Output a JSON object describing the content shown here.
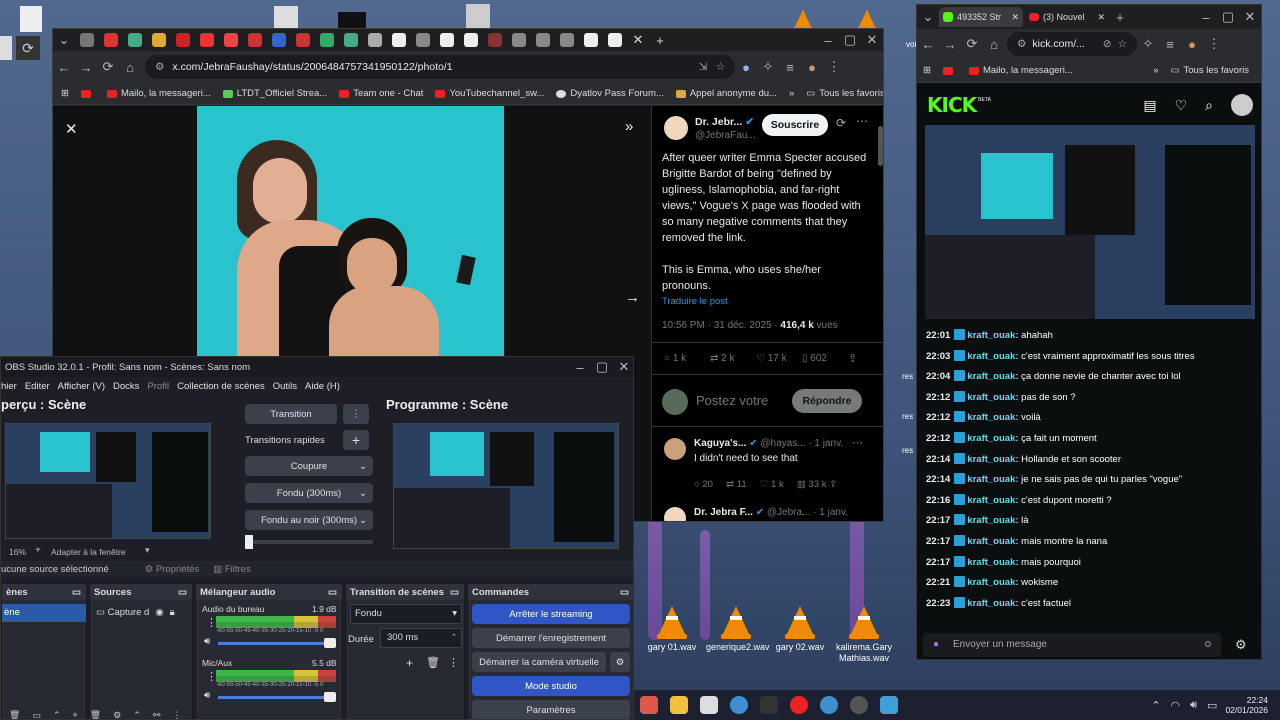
{
  "chrome_main": {
    "url": "x.com/JebraFaushay/status/2006484757341950122/photo/1",
    "bookmarks": [
      "Mailo, la messageri...",
      "LTDT_Officiel Strea...",
      "Team one - Chat",
      "YouTubechannel_sw...",
      "Dyatlov Pass Forum...",
      "Appel anonyme du..."
    ],
    "all_bookmarks": "Tous les favoris"
  },
  "tweet": {
    "author": "Dr. Jebr...",
    "handle": "@JebraFau...",
    "follow": "Suivre",
    "subscribe": "Souscrire",
    "text": "After queer writer Emma Specter accused Brigitte Bardot of being \"defined by ugliness, Islamophobia, and far-right views,\" Vogue's X page was flooded with so many negative comments that they removed the link.",
    "text2": "This is Emma, who uses she/her pronouns.",
    "translate": "Traduire le post",
    "time": "10:56 PM · 31 déc. 2025 · ",
    "views_count": "416,4 k",
    "views_label": " vues",
    "replies": "1 k",
    "retweets": "2 k",
    "likes": "17 k",
    "bookmarks": "602",
    "reply_placeholder": "Postez votre",
    "reply_button": "Répondre",
    "reply1_name": "Kaguya's...",
    "reply1_handle": "@hayas...",
    "reply1_date": "· 1 janv.",
    "reply1_text": "I didn't need to see that",
    "reply1_replies": "20",
    "reply1_rts": "11",
    "reply1_likes": "1 k",
    "reply1_views": "33 k",
    "reply2_name": "Dr. Jebra F...",
    "reply2_handle": "@Jebra...",
    "reply2_date": "· 1 janv."
  },
  "obs": {
    "title": "OBS Studio 32.0.1 - Profil: Sans nom - Scènes: Sans nom",
    "menu": [
      "hier",
      "Editer",
      "Afficher (V)",
      "Docks",
      "Profil",
      "Collection de scènes",
      "Outils",
      "Aide (H)"
    ],
    "preview_title": "perçu : Scène",
    "program_title": "Programme : Scène",
    "transition": "Transition",
    "quick_transitions": "Transitions rapides",
    "cut": "Coupure",
    "fade": "Fondu (300ms)",
    "fade_black": "Fondu au noir (300ms)",
    "zoom": "16%",
    "fit": "Adapter à la fenêtre",
    "no_source": "ucune source sélectionné",
    "properties": "Propriétés",
    "filters": "Filtres",
    "scenes_dock": "ènes",
    "scene_item": "ène",
    "sources_dock": "Sources",
    "source_item": "Capture d",
    "mixer_dock": "Mélangeur audio",
    "mixer1_name": "Audio du bureau",
    "mixer1_db": "1.9 dB",
    "mixer2_name": "Mic/Aux",
    "mixer2_db": "5.5 dB",
    "meter_scale": "-60-55-50-45-40-35-30-25-20-15-10 -5  0",
    "transitions_dock": "Transition de scènes",
    "transition_select": "Fondu",
    "duration_label": "Durée",
    "duration_value": "300 ms",
    "controls_dock": "Commandes",
    "stop_stream": "Arrêter le streaming",
    "start_rec": "Démarrer l'enregistrement",
    "start_vcam": "Démarrer la caméra virtuelle",
    "studio_mode": "Mode studio",
    "settings": "Paramètres"
  },
  "kick_window": {
    "tab1": "493352 Str",
    "tab2": "(3) Nouvel",
    "url": "kick.com/...",
    "bookmark1": "Mailo, la messageri...",
    "all_bookmarks": "Tous les favoris",
    "logo": "KICK",
    "beta": "BETA",
    "chat_placeholder": "Envoyer un message",
    "messages": [
      {
        "time": "22:01",
        "user": "kraft_ouak:",
        "text": "ahahah"
      },
      {
        "time": "22:03",
        "user": "kraft_ouak:",
        "text": "c'est vraiment approximatif les sous titres"
      },
      {
        "time": "22:04",
        "user": "kraft_ouak:",
        "text": "ça donne nevie de chanter avec toi lol"
      },
      {
        "time": "22:12",
        "user": "kraft_ouak:",
        "text": "pas de son ?"
      },
      {
        "time": "22:12",
        "user": "kraft_ouak:",
        "text": "voilà"
      },
      {
        "time": "22:12",
        "user": "kraft_ouak:",
        "text": "ça fait un moment"
      },
      {
        "time": "22:14",
        "user": "kraft_ouak:",
        "text": "Hollande et son scooter"
      },
      {
        "time": "22:14",
        "user": "kraft_ouak:",
        "text": "je ne sais pas de qui tu parles \"vogue\""
      },
      {
        "time": "22:16",
        "user": "kraft_ouak:",
        "text": "c'est dupont moretti ?"
      },
      {
        "time": "22:17",
        "user": "kraft_ouak:",
        "text": "là"
      },
      {
        "time": "22:17",
        "user": "kraft_ouak:",
        "text": "mais montre la nana"
      },
      {
        "time": "22:17",
        "user": "kraft_ouak:",
        "text": "mais pourquoi"
      },
      {
        "time": "22:21",
        "user": "kraft_ouak:",
        "text": "wokisme"
      },
      {
        "time": "22:23",
        "user": "kraft_ouak:",
        "text": "c'est factuel"
      }
    ]
  },
  "desktop": {
    "icons": [
      "gary 01.wav",
      "generique2.wav",
      "gary 02.wav",
      "kalirema.Gary Mathias.wav"
    ],
    "side_labels": [
      "voix",
      "res",
      "res",
      "res"
    ]
  },
  "taskbar": {
    "time": "22:24",
    "date": "02/01/2026"
  }
}
